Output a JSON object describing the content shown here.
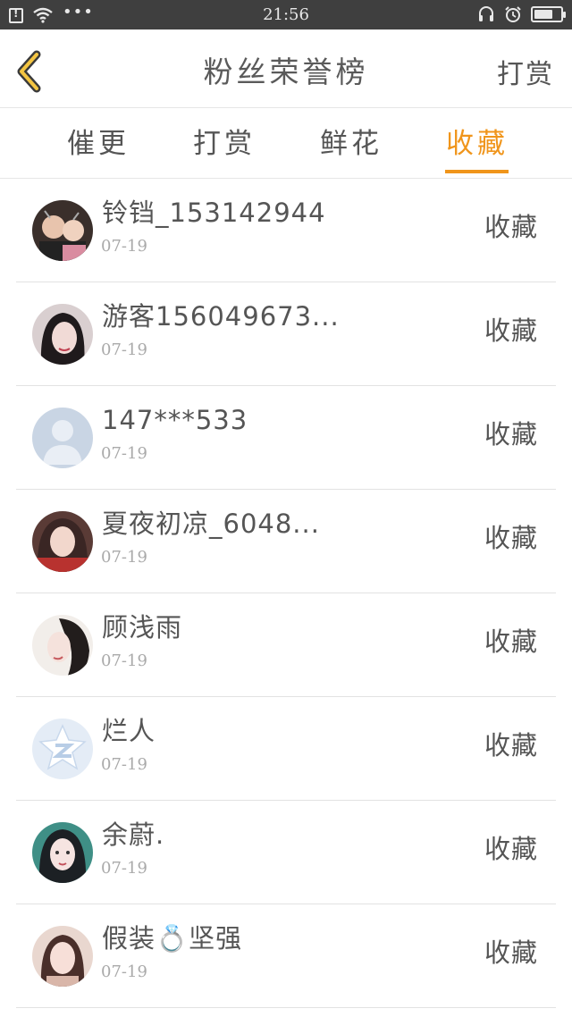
{
  "status_bar": {
    "time": "21:56",
    "dots": "•••"
  },
  "header": {
    "title": "粉丝荣誉榜",
    "right_action": "打赏"
  },
  "tabs": [
    {
      "label": "催更",
      "active": false
    },
    {
      "label": "打赏",
      "active": false
    },
    {
      "label": "鲜花",
      "active": false
    },
    {
      "label": "收藏",
      "active": true
    }
  ],
  "colors": {
    "accent": "#f0951b",
    "text": "#555555",
    "muted": "#aaaaaa",
    "status_bar": "#3f3f3f"
  },
  "fans": [
    {
      "name": "铃铛_153142944",
      "date": "07-19",
      "action": "收藏",
      "avatar": "photo-couple"
    },
    {
      "name": "游客156049673...",
      "date": "07-19",
      "action": "收藏",
      "avatar": "photo-girl-dark-hair"
    },
    {
      "name": "147***533",
      "date": "07-19",
      "action": "收藏",
      "avatar": "default-person"
    },
    {
      "name": "夏夜初凉_6048...",
      "date": "07-19",
      "action": "收藏",
      "avatar": "photo-girl-red"
    },
    {
      "name": "顾浅雨",
      "date": "07-19",
      "action": "收藏",
      "avatar": "photo-girl-light"
    },
    {
      "name": "烂人",
      "date": "07-19",
      "action": "收藏",
      "avatar": "qq-star-logo"
    },
    {
      "name": "余蔚.",
      "date": "07-19",
      "action": "收藏",
      "avatar": "photo-girl-teal"
    },
    {
      "name": "假装💍坚强",
      "date": "07-19",
      "action": "收藏",
      "avatar": "photo-girl-pink"
    }
  ]
}
